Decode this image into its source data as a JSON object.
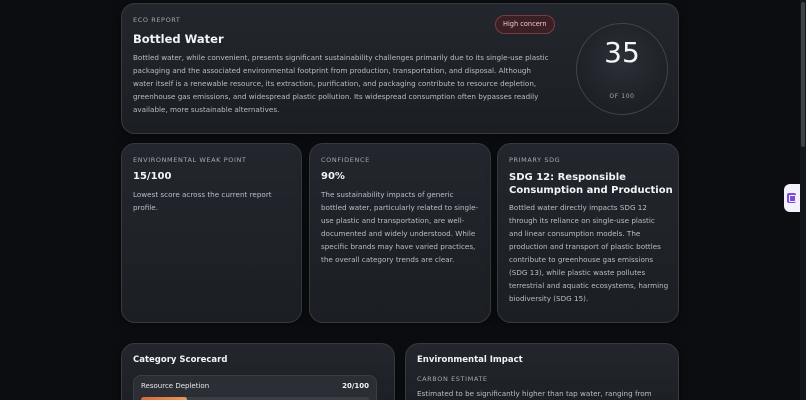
{
  "hero": {
    "overline": "ECO REPORT",
    "title": "Bottled Water",
    "badge": "High concern",
    "description": "Bottled water, while convenient, presents significant sustainability challenges primarily due to its single-use plastic packaging and the associated environmental footprint from production, transportation, and disposal. Although water itself is a renewable resource, its extraction, purification, and packaging contribute to resource depletion, greenhouse gas emissions, and widespread plastic pollution. Its widespread consumption often bypasses readily available, more sustainable alternatives.",
    "score": "35",
    "score_max_label": "OF 100"
  },
  "weak_point": {
    "overline": "ENVIRONMENTAL WEAK POINT",
    "value": "15/100",
    "description": "Lowest score across the current report profile."
  },
  "confidence": {
    "overline": "CONFIDENCE",
    "value": "90%",
    "description": "The sustainability impacts of generic bottled water, particularly related to single-use plastic and transportation, are well-documented and widely understood. While specific brands may have varied practices, the overall category trends are clear."
  },
  "sdg": {
    "overline": "PRIMARY SDG",
    "value": "SDG 12: Responsible Consumption and Production",
    "description": "Bottled water directly impacts SDG 12 through its reliance on single-use plastic and linear consumption models. The production and transport of plastic bottles contribute to greenhouse gas emissions (SDG 13), while plastic waste pollutes terrestrial and aquatic ecosystems, harming biodiversity (SDG 15)."
  },
  "scorecard": {
    "title": "Category Scorecard",
    "items": [
      {
        "label": "Resource Depletion",
        "score": "20/100",
        "fraction": 0.2
      }
    ]
  },
  "impact": {
    "title": "Environmental Impact",
    "overline": "CARBON ESTIMATE",
    "description": "Estimated to be significantly higher than tap water, ranging from"
  },
  "colors": {
    "badge_border": "#7a3c44",
    "bar_fill": "#d86a3c",
    "side_tab_accent": "#7c4ddb"
  },
  "icons": {
    "side_tab": "extension-icon"
  }
}
